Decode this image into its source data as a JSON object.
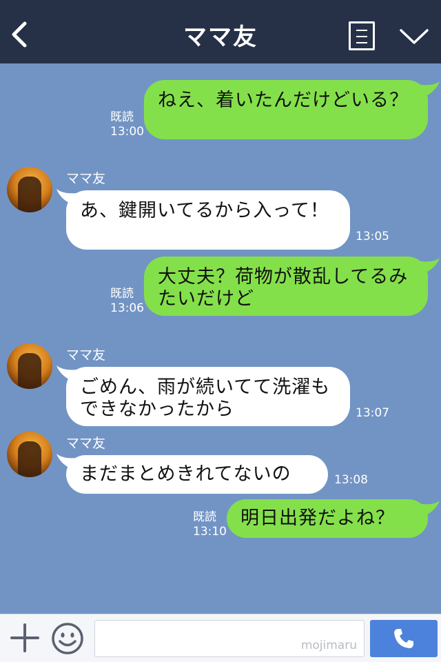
{
  "header": {
    "title": "ママ友",
    "icons": [
      "back-icon",
      "menu-icon",
      "chevron-down-icon"
    ]
  },
  "messages": [
    {
      "side": "me",
      "text": "ねえ、着いたんだけどいる？",
      "read": "既読",
      "time": "13:00"
    },
    {
      "side": "other",
      "sender": "ママ友",
      "text": "あ、鍵開いてるから入って！",
      "time": "13:05"
    },
    {
      "side": "me",
      "text": "大丈夫？荷物が散乱してるみたいだけど",
      "read": "既読",
      "time": "13:06"
    },
    {
      "side": "other",
      "sender": "ママ友",
      "text": "ごめん、雨が続いてて洗濯もできなかったから",
      "time": "13:07"
    },
    {
      "side": "other",
      "sender": "ママ友",
      "text": "まだまとめきれてないの",
      "time": "13:08"
    },
    {
      "side": "me",
      "text": "明日出発だよね？",
      "read": "既読",
      "time": "13:10"
    }
  ],
  "bottom": {
    "watermark": "mojimaru",
    "icons": [
      "plus-icon",
      "smile-icon",
      "phone-icon"
    ]
  },
  "colors": {
    "header_bg": "#263148",
    "chat_bg": "#7294c4",
    "my_bubble": "#84e04a",
    "their_bubble": "#ffffff",
    "call_button": "#4d82dc"
  }
}
